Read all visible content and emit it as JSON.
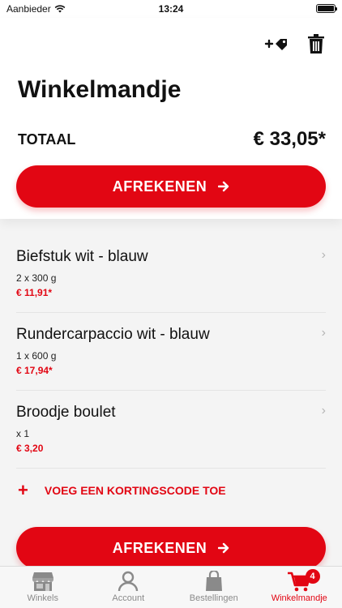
{
  "status_bar": {
    "carrier": "Aanbieder",
    "time": "13:24"
  },
  "header": {
    "title": "Winkelmandje",
    "total_label": "TOTAAL",
    "total_value": "€ 33,05*",
    "checkout_label": "AFREKENEN",
    "icons": [
      "add-tag-icon",
      "trash-icon"
    ]
  },
  "items": [
    {
      "name": "Biefstuk wit - blauw",
      "qty": "2 x 300 g",
      "price": "€ 11,91*"
    },
    {
      "name": "Rundercarpaccio wit - blauw",
      "qty": "1 x 600 g",
      "price": "€ 17,94*"
    },
    {
      "name": "Broodje boulet",
      "qty": "x 1",
      "price": "€ 3,20"
    }
  ],
  "discount_label": "VOEG EEN KORTINGSCODE TOE",
  "bottom_checkout_label": "AFREKENEN",
  "tabbar": {
    "tabs": [
      {
        "label": "Winkels",
        "icon": "store-icon"
      },
      {
        "label": "Account",
        "icon": "person-icon"
      },
      {
        "label": "Bestellingen",
        "icon": "bag-icon"
      },
      {
        "label": "Winkelmandje",
        "icon": "cart-icon",
        "badge": "4"
      }
    ]
  },
  "colors": {
    "accent": "#e20613",
    "background": "#f4f4f4",
    "inactive_tab": "#8a8a8a"
  }
}
